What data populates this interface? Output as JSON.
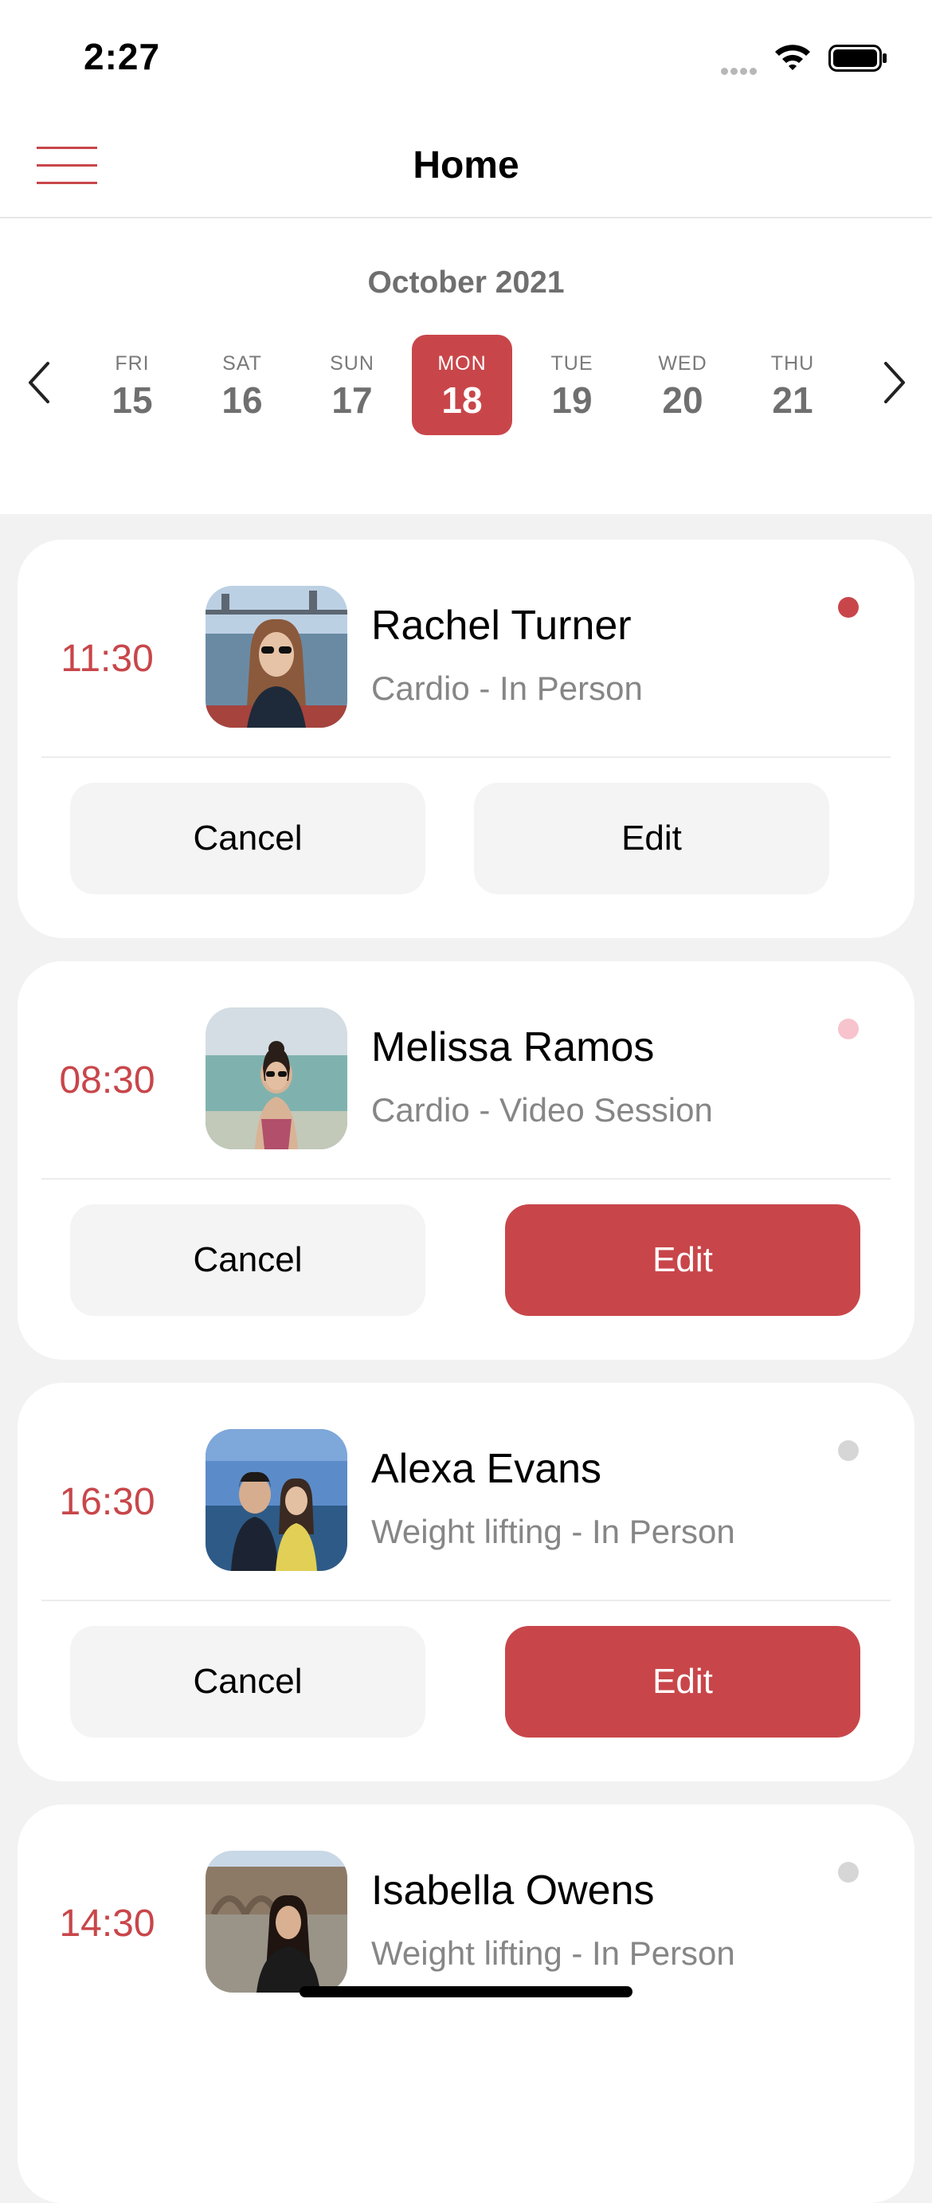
{
  "status_bar": {
    "time": "2:27"
  },
  "header": {
    "title": "Home",
    "menu_icon": "hamburger-menu-icon",
    "accent_color": "#c8464a"
  },
  "calendar": {
    "month": "October 2021",
    "prev_icon": "chevron-left-icon",
    "next_icon": "chevron-right-icon",
    "days": [
      {
        "dow": "FRI",
        "num": "15",
        "selected": false
      },
      {
        "dow": "SAT",
        "num": "16",
        "selected": false
      },
      {
        "dow": "SUN",
        "num": "17",
        "selected": false
      },
      {
        "dow": "MON",
        "num": "18",
        "selected": true
      },
      {
        "dow": "TUE",
        "num": "19",
        "selected": false
      },
      {
        "dow": "WED",
        "num": "20",
        "selected": false
      },
      {
        "dow": "THU",
        "num": "21",
        "selected": false
      }
    ]
  },
  "appointments": [
    {
      "time": "11:30",
      "name": "Rachel Turner",
      "session": "Cardio - In Person",
      "dot_color": "#c8464a",
      "cancel_label": "Cancel",
      "edit_label": "Edit",
      "edit_style": "plain"
    },
    {
      "time": "08:30",
      "name": "Melissa Ramos",
      "session": "Cardio - Video Session",
      "dot_color": "#f7c3cd",
      "cancel_label": "Cancel",
      "edit_label": "Edit",
      "edit_style": "primary"
    },
    {
      "time": "16:30",
      "name": "Alexa Evans",
      "session": "Weight lifting - In Person",
      "dot_color": "#d6d6d6",
      "cancel_label": "Cancel",
      "edit_label": "Edit",
      "edit_style": "primary"
    },
    {
      "time": "14:30",
      "name": "Isabella Owens",
      "session": "Weight lifting - In Person",
      "dot_color": "#d6d6d6"
    }
  ]
}
